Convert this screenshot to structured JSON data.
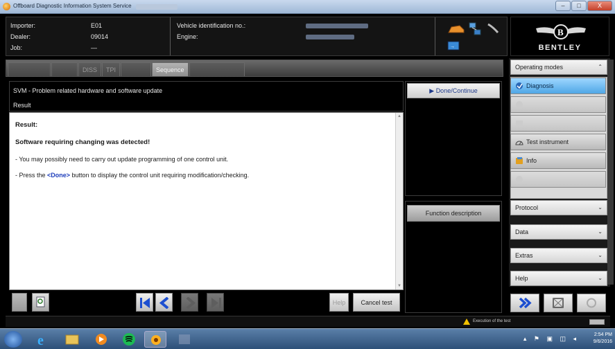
{
  "window": {
    "title": "Offboard Diagnostic Information System Service",
    "controls": {
      "minimize": "–",
      "maximize": "□",
      "close": "X"
    }
  },
  "header": {
    "importer_label": "Importer:",
    "importer_value": "E01",
    "dealer_label": "Dealer:",
    "dealer_value": "09014",
    "job_label": "Job:",
    "job_value": "—",
    "vin_label": "Vehicle identification no.:",
    "engine_label": "Engine:",
    "brand": "BENTLEY"
  },
  "tabs": [
    {
      "label": "",
      "active": false
    },
    {
      "label": "",
      "active": false
    },
    {
      "label": "DISS",
      "active": false
    },
    {
      "label": "TPI",
      "active": false
    },
    {
      "label": "",
      "active": false
    },
    {
      "label": "Sequence",
      "active": true
    },
    {
      "label": "",
      "active": false
    }
  ],
  "main": {
    "procedure_title": "SVM - Problem related hardware and software update",
    "section_label": "Result",
    "result_heading": "Result:",
    "detected_text": "Software requiring changing was detected!",
    "line1": "- You may possibly need to carry out update programming of one control unit.",
    "line2_pre": "- Press the ",
    "line2_done": "<Done>",
    "line2_post": " button to display the control unit requiring modification/checking."
  },
  "actions": {
    "done_continue": "Done/Continue",
    "function_description": "Function description",
    "help": "Help",
    "cancel_test": "Cancel test"
  },
  "sidebar": {
    "operating_modes": "Operating modes",
    "items": [
      {
        "label": "Diagnosis",
        "state": "selected"
      },
      {
        "label": "",
        "state": "disabled"
      },
      {
        "label": "",
        "state": "disabled"
      },
      {
        "label": "Test instrument",
        "state": "normal"
      },
      {
        "label": "Info",
        "state": "normal"
      },
      {
        "label": "",
        "state": "disabled"
      }
    ],
    "sections": [
      "Protocol",
      "Data",
      "Extras",
      "Help"
    ]
  },
  "status": {
    "message": "Execution of the test"
  },
  "taskbar": {
    "time": "2:54 PM",
    "date": "9/6/2016"
  },
  "colors": {
    "selected_mode": "#4fa7e6",
    "done_link": "#1d3dbb",
    "warning": "#f0c000"
  }
}
